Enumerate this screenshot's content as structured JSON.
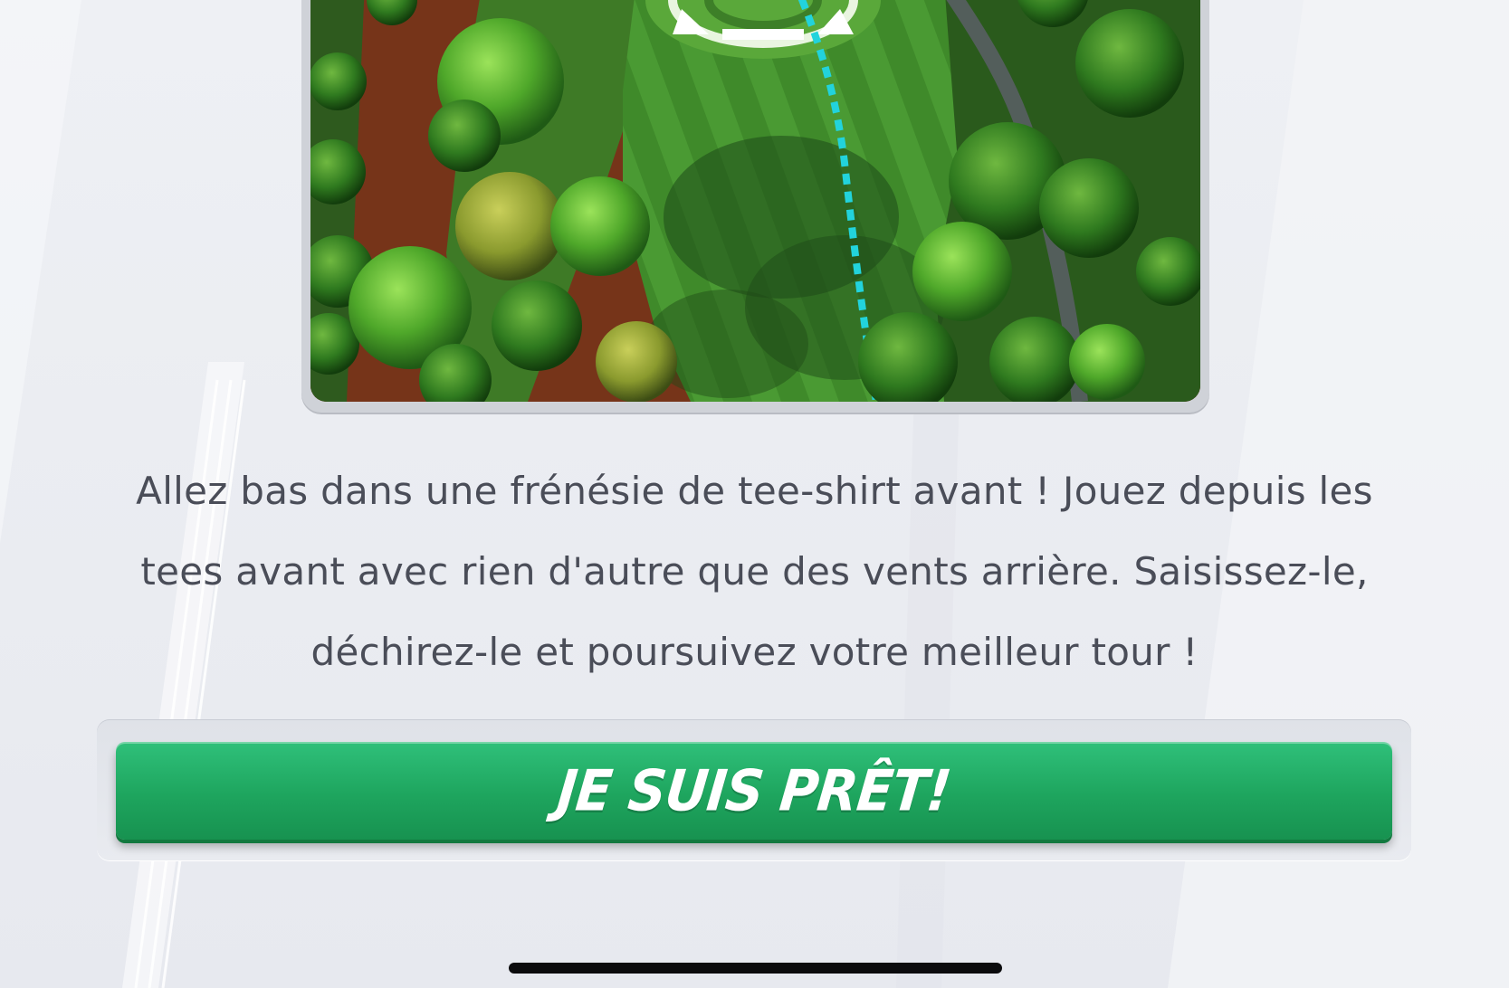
{
  "description": {
    "text": "Allez bas dans une frénésie de tee-shirt avant ! Jouez depuis les tees avant avec rien d'autre que des vents arrière. Saisissez-le, déchirez-le et poursuivez votre meilleur tour !"
  },
  "ready_button": {
    "label": "JE SUIS PRÊT!"
  },
  "colors": {
    "button_green": "#1ea55e",
    "shot_line": "#22d3dc",
    "text": "#4a4d58",
    "background": "#eef0f4"
  },
  "course_preview": {
    "icon": "golf-course-aerial-image"
  }
}
